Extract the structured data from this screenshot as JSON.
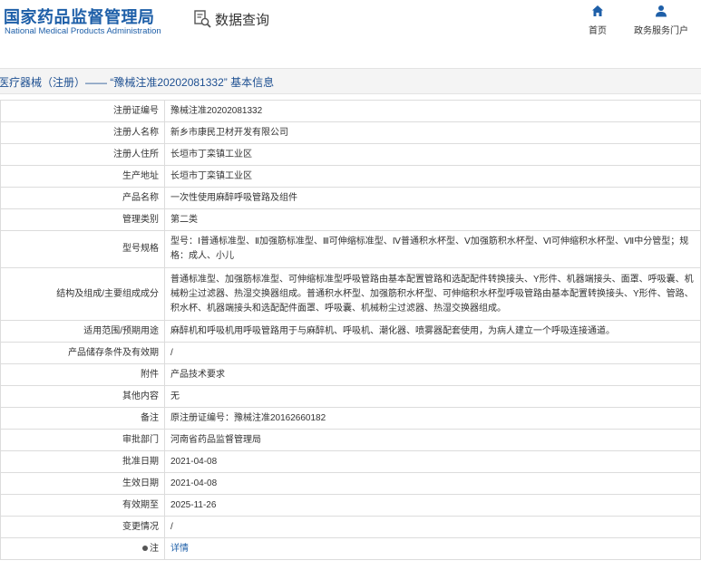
{
  "header": {
    "logo_cn": "国家药品监督管理局",
    "logo_en": "National Medical Products Administration",
    "query_label": "数据查询",
    "nav": {
      "home_label": "首页",
      "portal_label": "政务服务门户"
    }
  },
  "title": "医疗器械（注册）—— “豫械注准20202081332” 基本信息",
  "rows": [
    {
      "label": "注册证编号",
      "value": "豫械注准20202081332"
    },
    {
      "label": "注册人名称",
      "value": "新乡市康民卫材开发有限公司"
    },
    {
      "label": "注册人住所",
      "value": "长垣市丁栾镇工业区"
    },
    {
      "label": "生产地址",
      "value": "长垣市丁栾镇工业区"
    },
    {
      "label": "产品名称",
      "value": "一次性使用麻醉呼吸管路及组件"
    },
    {
      "label": "管理类别",
      "value": "第二类"
    },
    {
      "label": "型号规格",
      "value": "型号：Ⅰ普通标准型、Ⅱ加强筋标准型、Ⅲ可伸缩标准型、Ⅳ普通积水杯型、Ⅴ加强筋积水杯型、Ⅵ可伸缩积水杯型、Ⅶ中分管型；规格：成人、小儿"
    },
    {
      "label": "结构及组成/主要组成成分",
      "value": "普通标准型、加强筋标准型、可伸缩标准型呼吸管路由基本配置管路和选配配件转换接头、Y形件、机器端接头、面罩、呼吸囊、机械粉尘过滤器、热湿交换器组成。普通积水杯型、加强筋积水杯型、可伸缩积水杯型呼吸管路由基本配置转换接头、Y形件、管路、积水杯、机器端接头和选配配件面罩、呼吸囊、机械粉尘过滤器、热湿交换器组成。"
    },
    {
      "label": "适用范围/预期用途",
      "value": "麻醉机和呼吸机用呼吸管路用于与麻醉机、呼吸机、潮化器、喷雾器配套使用，为病人建立一个呼吸连接通道。"
    },
    {
      "label": "产品储存条件及有效期",
      "value": "/"
    },
    {
      "label": "附件",
      "value": "产品技术要求"
    },
    {
      "label": "其他内容",
      "value": "无"
    },
    {
      "label": "备注",
      "value": "原注册证编号：豫械注准20162660182"
    },
    {
      "label": "审批部门",
      "value": "河南省药品监督管理局"
    },
    {
      "label": "批准日期",
      "value": "2021-04-08"
    },
    {
      "label": "生效日期",
      "value": "2021-04-08"
    },
    {
      "label": "有效期至",
      "value": "2025-11-26"
    },
    {
      "label": "变更情况",
      "value": "/"
    }
  ],
  "note_row": {
    "label": "注",
    "link_text": "详情"
  },
  "colors": {
    "brand_blue": "#1e5fa8",
    "title_blue": "#1d4f91",
    "border": "#dcdcdc"
  }
}
